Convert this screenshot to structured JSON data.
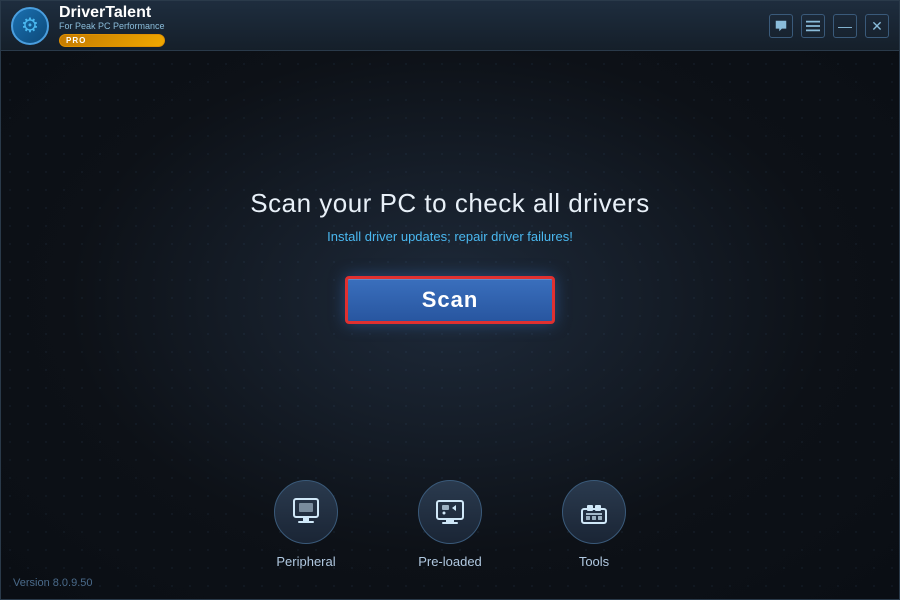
{
  "app": {
    "title": "Driver Talent",
    "title_part1": "Driver",
    "title_part2": "Talent",
    "tagline": "For Peak PC Performance",
    "pro_badge": "PRO",
    "version": "Version 8.0.9.50"
  },
  "titlebar": {
    "chat_btn": "💬",
    "menu_btn": "☰",
    "minimize_btn": "—",
    "close_btn": "✕"
  },
  "main": {
    "headline": "Scan your PC to check all drivers",
    "subheadline": "Install driver updates; repair driver failures!",
    "scan_button_label": "Scan"
  },
  "toolbar": {
    "items": [
      {
        "id": "peripheral",
        "label": "Peripheral"
      },
      {
        "id": "preloaded",
        "label": "Pre-loaded"
      },
      {
        "id": "tools",
        "label": "Tools"
      }
    ]
  }
}
